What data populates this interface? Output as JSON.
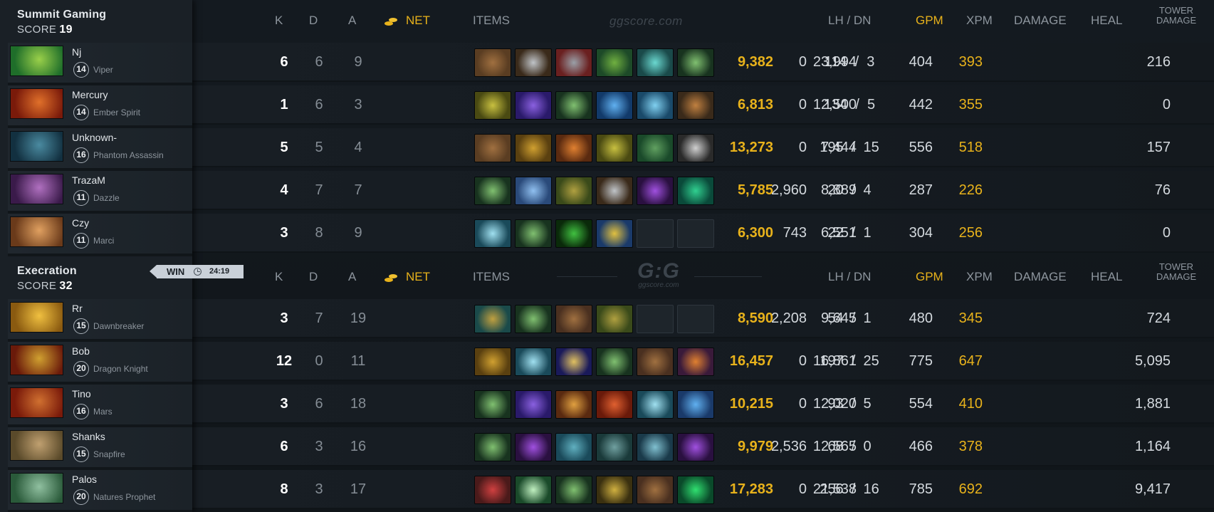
{
  "colors": {
    "accent_gold": "#e8b21b",
    "text_dim": "#858d95",
    "bg": "#12171c"
  },
  "columns": {
    "k": "K",
    "d": "D",
    "a": "A",
    "net": "NET",
    "items": "ITEMS",
    "lh_dn": "LH / DN",
    "gpm": "GPM",
    "xpm": "XPM",
    "damage": "DAMAGE",
    "heal": "HEAL",
    "tower_1": "TOWER",
    "tower_2": "DAMAGE"
  },
  "watermark": {
    "site": "ggscore.com",
    "logo": "G:G"
  },
  "result": {
    "label": "WIN",
    "duration": "24:19",
    "icon": "clock-icon"
  },
  "teams": [
    {
      "name": "Summit Gaming",
      "score_label": "SCORE",
      "score": "19",
      "players": [
        {
          "name": "Nj",
          "level": "14",
          "hero": "Viper",
          "k": "6",
          "d": "6",
          "a": "9",
          "net": "9,382",
          "lh_dn": "114  /  3",
          "gpm": "393",
          "xpm": "404",
          "damage": "23,994",
          "heal": "0",
          "tower": "216",
          "portrait": [
            "#1f6e2a",
            "#9ad04a"
          ],
          "items": [
            [
              "#5a3d22",
              "#a07040"
            ],
            [
              "#3a2a1a",
              "#c0c4c8"
            ],
            [
              "#6a2020",
              "#9aa0a8"
            ],
            [
              "#1d4a28",
              "#70b040"
            ],
            [
              "#1a4a4a",
              "#6ad8d0"
            ],
            [
              "#18331f",
              "#80c070"
            ]
          ]
        },
        {
          "name": "Mercury",
          "level": "14",
          "hero": "Ember Spirit",
          "k": "1",
          "d": "6",
          "a": "3",
          "net": "6,813",
          "lh_dn": "134  /  5",
          "gpm": "355",
          "xpm": "442",
          "damage": "12,500",
          "heal": "0",
          "tower": "0",
          "portrait": [
            "#7a1a0a",
            "#e0702a"
          ],
          "items": [
            [
              "#4a4a12",
              "#c8c040"
            ],
            [
              "#2a1a6a",
              "#8a60e0"
            ],
            [
              "#18331f",
              "#80c070"
            ],
            [
              "#123a6a",
              "#60b0f0"
            ],
            [
              "#1a4a6a",
              "#80d0f0"
            ],
            [
              "#3a2a1a",
              "#c08040"
            ]
          ]
        },
        {
          "name": "Unknown-",
          "level": "16",
          "hero": "Phantom Assassin",
          "k": "5",
          "d": "5",
          "a": "4",
          "net": "13,273",
          "lh_dn": "195  /  15",
          "gpm": "518",
          "xpm": "556",
          "damage": "7,444",
          "heal": "0",
          "tower": "157",
          "portrait": [
            "#123040",
            "#4a8aa0"
          ],
          "items": [
            [
              "#5a3d22",
              "#a07040"
            ],
            [
              "#5a4010",
              "#d0a030"
            ],
            [
              "#5a2a10",
              "#e08030"
            ],
            [
              "#4a4a12",
              "#c8c040"
            ],
            [
              "#1a4a2a",
              "#60a060"
            ],
            [
              "#2a2a2a",
              "#d0d0d0"
            ]
          ]
        },
        {
          "name": "TrazaM",
          "level": "11",
          "hero": "Dazzle",
          "k": "4",
          "d": "7",
          "a": "7",
          "net": "5,785",
          "lh_dn": "20  /  4",
          "gpm": "226",
          "xpm": "287",
          "damage": "8,889",
          "heal": "2,960",
          "tower": "76",
          "portrait": [
            "#3a1a4a",
            "#b070c0"
          ],
          "items": [
            [
              "#18331f",
              "#80c070"
            ],
            [
              "#2a4a7a",
              "#90c0f0"
            ],
            [
              "#3a4a1a",
              "#b0a040"
            ],
            [
              "#3a2a1a",
              "#c0c4c8"
            ],
            [
              "#2a1040",
              "#a050e0"
            ],
            [
              "#0a4a3a",
              "#30d090"
            ]
          ]
        },
        {
          "name": "Czy",
          "level": "11",
          "hero": "Marci",
          "k": "3",
          "d": "8",
          "a": "9",
          "net": "6,300",
          "lh_dn": "22  /  1",
          "gpm": "256",
          "xpm": "304",
          "damage": "6,551",
          "heal": "743",
          "tower": "0",
          "portrait": [
            "#6a3a1a",
            "#e0a060"
          ],
          "items": [
            [
              "#1a4a5a",
              "#a0e0f0"
            ],
            [
              "#18331f",
              "#80c070"
            ],
            [
              "#0a2a0a",
              "#40c040"
            ],
            [
              "#1a3a6a",
              "#e0c040"
            ],
            null,
            null
          ]
        }
      ]
    },
    {
      "name": "Execration",
      "score_label": "SCORE",
      "score": "32",
      "players": [
        {
          "name": "Rr",
          "level": "15",
          "hero": "Dawnbreaker",
          "k": "3",
          "d": "7",
          "a": "19",
          "net": "8,590",
          "lh_dn": "54  /  1",
          "gpm": "345",
          "xpm": "480",
          "damage": "9,645",
          "heal": "2,208",
          "tower": "724",
          "portrait": [
            "#8a5a10",
            "#f0c040"
          ],
          "items": [
            [
              "#1a4a4a",
              "#c0a040"
            ],
            [
              "#18331f",
              "#80c070"
            ],
            [
              "#4a3020",
              "#a07040"
            ],
            [
              "#3a4a1a",
              "#b0a040"
            ],
            null,
            null
          ]
        },
        {
          "name": "Bob",
          "level": "20",
          "hero": "Dragon Knight",
          "k": "12",
          "d": "0",
          "a": "11",
          "net": "16,457",
          "lh_dn": "197  /  25",
          "gpm": "647",
          "xpm": "775",
          "damage": "16,861",
          "heal": "0",
          "tower": "5,095",
          "portrait": [
            "#6a1a0a",
            "#d0a030"
          ],
          "items": [
            [
              "#5a4010",
              "#d0a030"
            ],
            [
              "#1a4a5a",
              "#a0e0f0"
            ],
            [
              "#1a1a5a",
              "#e0c060"
            ],
            [
              "#18331f",
              "#80c070"
            ],
            [
              "#4a3020",
              "#a07040"
            ],
            [
              "#3a1a3a",
              "#e08030"
            ]
          ]
        },
        {
          "name": "Tino",
          "level": "16",
          "hero": "Mars",
          "k": "3",
          "d": "6",
          "a": "18",
          "net": "10,215",
          "lh_dn": "93  /  5",
          "gpm": "410",
          "xpm": "554",
          "damage": "12,020",
          "heal": "0",
          "tower": "1,881",
          "portrait": [
            "#7a1a0a",
            "#d07030"
          ],
          "items": [
            [
              "#18331f",
              "#80c070"
            ],
            [
              "#2a1a6a",
              "#8a60e0"
            ],
            [
              "#5a2a10",
              "#e0a040"
            ],
            [
              "#6a1a0a",
              "#e06030"
            ],
            [
              "#1a4a5a",
              "#a0e0f0"
            ],
            [
              "#1a3a6a",
              "#60b0f0"
            ]
          ]
        },
        {
          "name": "Shanks",
          "level": "15",
          "hero": "Snapfire",
          "k": "6",
          "d": "3",
          "a": "16",
          "net": "9,979",
          "lh_dn": "68  /  0",
          "gpm": "378",
          "xpm": "466",
          "damage": "12,565",
          "heal": "2,536",
          "tower": "1,164",
          "portrait": [
            "#5a4a2a",
            "#c0a070"
          ],
          "items": [
            [
              "#18331f",
              "#80c070"
            ],
            [
              "#2a1040",
              "#a050e0"
            ],
            [
              "#1a4a5a",
              "#60b0c0"
            ],
            [
              "#1a3a3a",
              "#70a0a0"
            ],
            [
              "#1a3a4a",
              "#80c0d0"
            ],
            [
              "#2a1040",
              "#a050e0"
            ]
          ]
        },
        {
          "name": "Palos",
          "level": "20",
          "hero": "Natures Prophet",
          "k": "8",
          "d": "3",
          "a": "17",
          "net": "17,283",
          "lh_dn": "256  /  16",
          "gpm": "692",
          "xpm": "785",
          "damage": "21,538",
          "heal": "0",
          "tower": "9,417",
          "portrait": [
            "#2a5a3a",
            "#90c0a0"
          ],
          "items": [
            [
              "#4a1a1a",
              "#d04040"
            ],
            [
              "#1a4a2a",
              "#c0f0c0"
            ],
            [
              "#18331f",
              "#80c070"
            ],
            [
              "#3a3010",
              "#d0b040"
            ],
            [
              "#4a3020",
              "#a07040"
            ],
            [
              "#0a4a2a",
              "#30e070"
            ]
          ]
        }
      ]
    }
  ]
}
